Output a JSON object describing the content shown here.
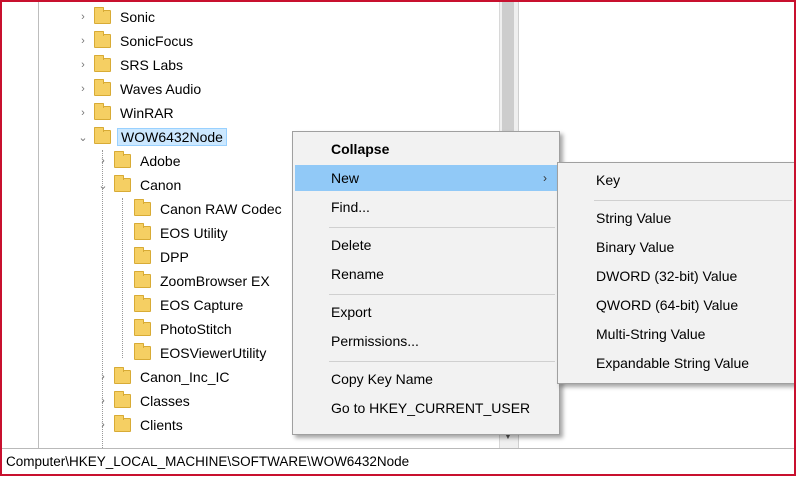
{
  "tree": {
    "items": [
      {
        "label": "Sonic",
        "indent": 0,
        "expander": "›"
      },
      {
        "label": "SonicFocus",
        "indent": 0,
        "expander": "›"
      },
      {
        "label": "SRS Labs",
        "indent": 0,
        "expander": "›"
      },
      {
        "label": "Waves Audio",
        "indent": 0,
        "expander": "›"
      },
      {
        "label": "WinRAR",
        "indent": 0,
        "expander": "›"
      },
      {
        "label": "WOW6432Node",
        "indent": 0,
        "expander": "⌄",
        "selected": true
      },
      {
        "label": "Adobe",
        "indent": 1,
        "expander": "›"
      },
      {
        "label": "Canon",
        "indent": 1,
        "expander": "⌄"
      },
      {
        "label": "Canon RAW Codec",
        "indent": 2,
        "expander": ""
      },
      {
        "label": "EOS Utility",
        "indent": 2,
        "expander": ""
      },
      {
        "label": "DPP",
        "indent": 2,
        "expander": ""
      },
      {
        "label": "ZoomBrowser EX",
        "indent": 2,
        "expander": ""
      },
      {
        "label": "EOS Capture",
        "indent": 2,
        "expander": ""
      },
      {
        "label": "PhotoStitch",
        "indent": 2,
        "expander": ""
      },
      {
        "label": "EOSViewerUtility",
        "indent": 2,
        "expander": ""
      },
      {
        "label": "Canon_Inc_IC",
        "indent": 1,
        "expander": "›"
      },
      {
        "label": "Classes",
        "indent": 1,
        "expander": "›"
      },
      {
        "label": "Clients",
        "indent": 1,
        "expander": "›"
      }
    ]
  },
  "context_menu": {
    "items": [
      {
        "label": "Collapse",
        "bold": true
      },
      {
        "label": "New",
        "highlighted": true,
        "has_submenu": true
      },
      {
        "label": "Find..."
      },
      {
        "separator": true
      },
      {
        "label": "Delete"
      },
      {
        "label": "Rename"
      },
      {
        "separator": true
      },
      {
        "label": "Export"
      },
      {
        "label": "Permissions..."
      },
      {
        "separator": true
      },
      {
        "label": "Copy Key Name"
      },
      {
        "label": "Go to HKEY_CURRENT_USER"
      }
    ]
  },
  "new_submenu": {
    "items": [
      {
        "label": "Key"
      },
      {
        "separator": true
      },
      {
        "label": "String Value"
      },
      {
        "label": "Binary Value"
      },
      {
        "label": "DWORD (32-bit) Value"
      },
      {
        "label": "QWORD (64-bit) Value"
      },
      {
        "label": "Multi-String Value"
      },
      {
        "label": "Expandable String Value"
      }
    ]
  },
  "statusbar": {
    "path": "Computer\\HKEY_LOCAL_MACHINE\\SOFTWARE\\WOW6432Node"
  },
  "colors": {
    "frame_border": "#c8102e",
    "selection": "#cce8ff",
    "menu_highlight": "#91c9f7",
    "folder": "#f5cf63"
  }
}
